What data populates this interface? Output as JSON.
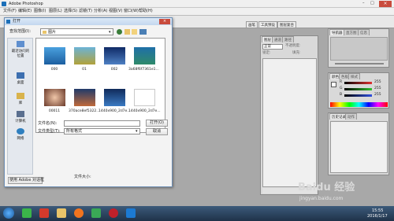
{
  "window": {
    "title": "Adobe Photoshop"
  },
  "menubar": {
    "items": [
      "文件(F)",
      "编辑(E)",
      "图像(I)",
      "图层(L)",
      "选择(S)",
      "滤镜(T)",
      "分析(A)",
      "视图(V)",
      "窗口(W)",
      "帮助(H)"
    ]
  },
  "options_bar": {
    "tabs": [
      "画笔",
      "工具预设",
      "图层复合"
    ]
  },
  "dialog": {
    "title": "打开",
    "lookin_label": "查找范围(I):",
    "lookin_value": "图片",
    "places": [
      {
        "label": "最近访问的位置",
        "icon": "recent-places-icon"
      },
      {
        "label": "桌面",
        "icon": "desktop-icon"
      },
      {
        "label": "库",
        "icon": "libraries-icon"
      },
      {
        "label": "计算机",
        "icon": "computer-icon"
      },
      {
        "label": "网络",
        "icon": "network-icon"
      }
    ],
    "files": [
      {
        "name": "000",
        "color": "#2c7fc0"
      },
      {
        "name": "01",
        "color": "#b2a23a"
      },
      {
        "name": "002",
        "color": "#1c3c86"
      },
      {
        "name": "3a68f6f7361e1...",
        "color": "#2f8a6a"
      },
      {
        "name": "00011",
        "color": "#c37a54"
      },
      {
        "name": "370ace8ef5322...",
        "color": "#c06a3a"
      },
      {
        "name": "1440x900_2d7e...",
        "color": "#1b3e7a"
      },
      {
        "name": "1440x900_2d7e...",
        "color": "#ffffff"
      }
    ],
    "filename_label": "文件名(N):",
    "filename_value": "",
    "filetype_label": "文件类型(T):",
    "filetype_value": "所有格式",
    "open_button": "打开(O)",
    "cancel_button": "取消",
    "use_adobe_dialog_button": "使用 Adobe 对话框",
    "filesize_label": "文件大小:"
  },
  "layers_panel": {
    "tabs": [
      "图层",
      "通道",
      "路径"
    ],
    "blend_mode": "正常",
    "opacity_label": "不透明度:",
    "lock_label": "锁定:",
    "fill_label": "填充:"
  },
  "navigator_panel": {
    "tabs": [
      "导航器",
      "直方图",
      "信息"
    ]
  },
  "color_panel": {
    "tabs": [
      "颜色",
      "色板",
      "样式"
    ],
    "channels": [
      {
        "label": "R",
        "value": "255",
        "color": "#e03030"
      },
      {
        "label": "G",
        "value": "255",
        "color": "#30c030"
      },
      {
        "label": "B",
        "value": "255",
        "color": "#3050e0"
      }
    ]
  },
  "history_panel": {
    "tabs": [
      "历史记录",
      "动作"
    ]
  },
  "taskbar": {
    "apps": [
      {
        "icon": "qq-icon",
        "color": "#3bb54a"
      },
      {
        "icon": "browser-icon",
        "color": "#d33a2c"
      },
      {
        "icon": "folder-icon",
        "color": "#e9c46a"
      },
      {
        "icon": "firefox-icon",
        "color": "#f2741f"
      },
      {
        "icon": "media-player-icon",
        "color": "#3aa856"
      },
      {
        "icon": "record-icon",
        "color": "#c0202a"
      },
      {
        "icon": "photoshop-icon",
        "color": "#1c7ad3"
      }
    ],
    "time": "15:55",
    "date": "2016/1/17"
  },
  "watermark": {
    "text": "Baidu 经验",
    "sub": "jingyan.baidu.com"
  }
}
